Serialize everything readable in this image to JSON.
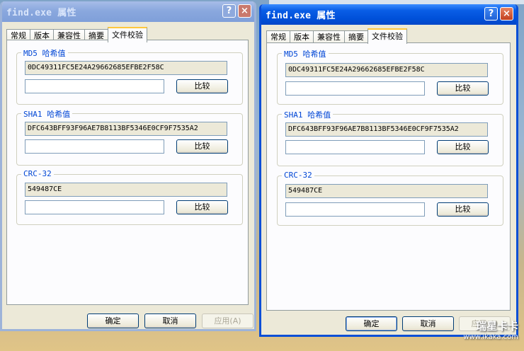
{
  "left_dialog": {
    "title": "find.exe 属性",
    "help": "?",
    "close": "×",
    "tabs": [
      "常规",
      "版本",
      "兼容性",
      "摘要",
      "文件校验"
    ],
    "md5": {
      "label": "MD5 哈希值",
      "value": "0DC49311FC5E24A29662685EFBE2F58C",
      "compare": "比较"
    },
    "sha1": {
      "label": "SHA1 哈希值",
      "value": "DFC643BFF93F96AE7B8113BF5346E0CF9F7535A2",
      "compare": "比较"
    },
    "crc": {
      "label": "CRC-32",
      "value": "549487CE",
      "compare": "比较"
    },
    "ok": "确定",
    "cancel": "取消",
    "apply": "应用(A)"
  },
  "right_dialog": {
    "title": "find.exe 属性",
    "help": "?",
    "close": "×",
    "tabs": [
      "常规",
      "版本",
      "兼容性",
      "摘要",
      "文件校验"
    ],
    "md5": {
      "label": "MD5 哈希值",
      "value": "0DC49311FC5E24A29662685EFBE2F58C",
      "compare": "比较"
    },
    "sha1": {
      "label": "SHA1 哈希值",
      "value": "DFC643BFF93F96AE7B8113BF5346E0CF9F7535A2",
      "compare": "比较"
    },
    "crc": {
      "label": "CRC-32",
      "value": "549487CE",
      "compare": "比较"
    },
    "ok": "确定",
    "cancel": "取消",
    "apply": "应用(A)"
  },
  "watermark": {
    "brand": "瑞星卡卡",
    "url": "www.ikaka.com"
  },
  "colors": {
    "active_title": "#0050d9",
    "inactive_title": "#8aa8de",
    "group_label": "#0046d5",
    "dialog_bg": "#ece9d8"
  }
}
